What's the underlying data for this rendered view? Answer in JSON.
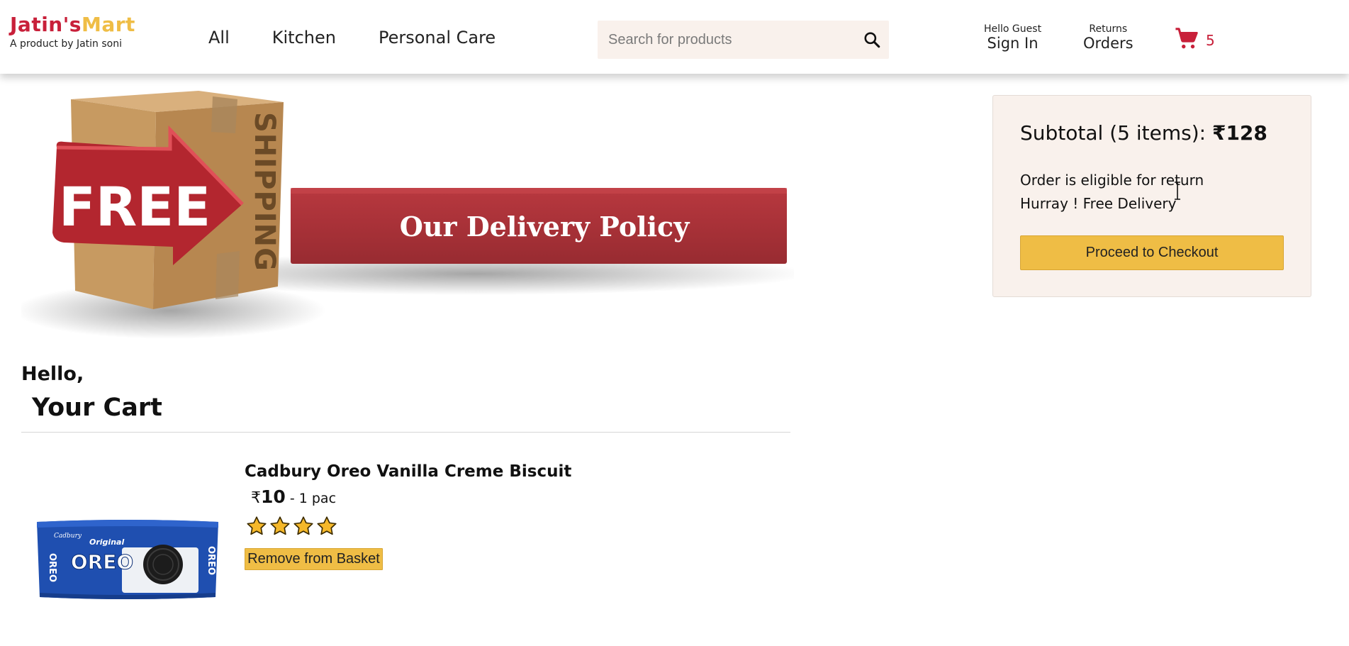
{
  "logo": {
    "part1": "Jatin's",
    "part2": "Mart",
    "tagline": "A product by Jatin soni"
  },
  "nav": {
    "items": [
      "All",
      "Kitchen",
      "Personal Care"
    ]
  },
  "search": {
    "placeholder": "Search for products",
    "value": ""
  },
  "header_options": {
    "signin": {
      "line1": "Hello Guest",
      "line2": "Sign In"
    },
    "orders": {
      "line1": "Returns",
      "line2": "Orders"
    },
    "cart": {
      "count": "5",
      "icon": "cart-icon"
    }
  },
  "banner": {
    "free_text": "FREE",
    "side_text": "SHIPPING",
    "ribbon_text": "Our Delivery Policy"
  },
  "subtotal": {
    "label": "Subtotal (5 items): ",
    "amount": "₹128",
    "eligible": "Order is eligible for return",
    "free_delivery": "Hurray ! Free Delivery",
    "checkout_label": "Proceed to Checkout"
  },
  "cart_section": {
    "hello": "Hello,",
    "title": "Your Cart"
  },
  "items": [
    {
      "title": "Cadbury Oreo Vanilla Creme Biscuit",
      "currency": "₹",
      "price": "10",
      "unit": " - 1 pac",
      "rating": 4,
      "remove_label": "Remove from Basket",
      "package_brand": "Cadbury",
      "package_name": "OREO",
      "package_tag": "Original"
    }
  ],
  "colors": {
    "brand_red": "#c8203a",
    "brand_yellow": "#efbd45",
    "panel_bg": "#f9f1ec"
  }
}
